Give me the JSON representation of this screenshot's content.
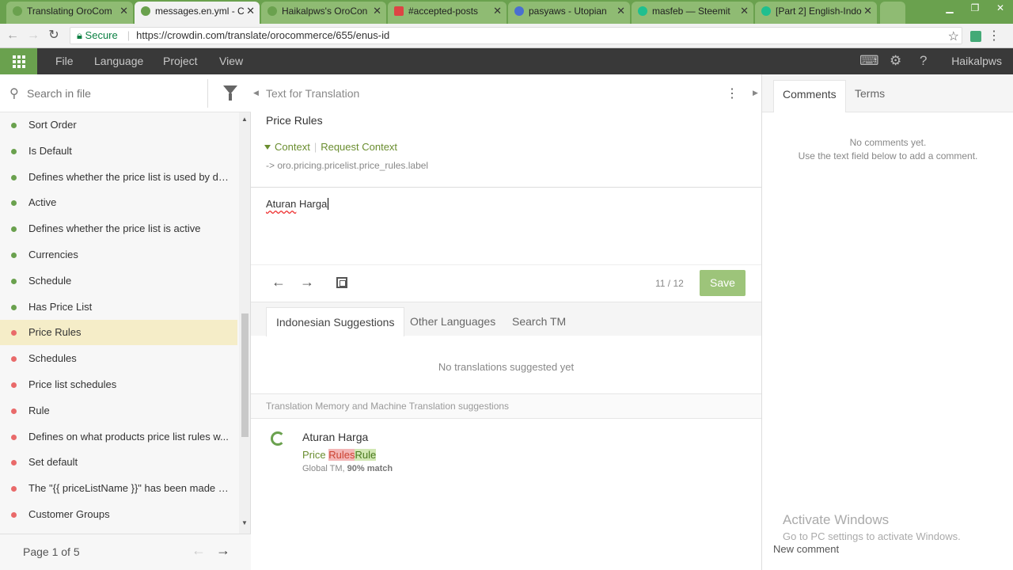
{
  "browser": {
    "tabs": [
      {
        "title": "Translating OroCom",
        "active": false
      },
      {
        "title": "messages.en.yml - C",
        "active": true
      },
      {
        "title": "Haikalpws's OroCon",
        "active": false
      },
      {
        "title": "#accepted-posts",
        "active": false
      },
      {
        "title": "pasyaws - Utopian",
        "active": false
      },
      {
        "title": "masfeb — Steemit",
        "active": false
      },
      {
        "title": "[Part 2] English-Indo",
        "active": false
      }
    ],
    "secure_label": "Secure",
    "url": "https://crowdin.com/translate/orocommerce/655/enus-id"
  },
  "appbar": {
    "menu": [
      "File",
      "Language",
      "Project",
      "View"
    ],
    "username": "Haikalpws",
    "icons": [
      "keyboard-icon",
      "gear-icon",
      "help-icon"
    ]
  },
  "left": {
    "search_placeholder": "Search in file",
    "items": [
      {
        "label": "Sort Order",
        "status": "green"
      },
      {
        "label": "Is Default",
        "status": "green"
      },
      {
        "label": "Defines whether the price list is used by de...",
        "status": "green"
      },
      {
        "label": "Active",
        "status": "green"
      },
      {
        "label": "Defines whether the price list is active",
        "status": "green"
      },
      {
        "label": "Currencies",
        "status": "green"
      },
      {
        "label": "Schedule",
        "status": "green"
      },
      {
        "label": "Has Price List",
        "status": "green"
      },
      {
        "label": "Price Rules",
        "status": "red",
        "selected": true
      },
      {
        "label": "Schedules",
        "status": "red"
      },
      {
        "label": "Price list schedules",
        "status": "red"
      },
      {
        "label": "Rule",
        "status": "red"
      },
      {
        "label": "Defines on what products price list rules w...",
        "status": "red"
      },
      {
        "label": "Set default",
        "status": "red"
      },
      {
        "label": "The \"{{ priceListName }}\" has been made d...",
        "status": "red"
      },
      {
        "label": "Customer Groups",
        "status": "red"
      }
    ],
    "pager": "Page 1 of 5"
  },
  "editor": {
    "header": "Text for Translation",
    "source_text": "Price Rules",
    "context_label": "Context",
    "request_context": "Request Context",
    "context_key": "-> oro.pricing.pricelist.price_rules.label",
    "translation_word1": "Aturan",
    "translation_word2": "Harga",
    "counter": "11 / 12",
    "save_label": "Save",
    "sug_tabs": [
      "Indonesian Suggestions",
      "Other Languages",
      "Search TM"
    ],
    "no_suggestions": "No translations suggested yet",
    "tm_header": "Translation Memory and Machine Translation suggestions",
    "tm": {
      "translation": "Aturan Harga",
      "src_prefix": "Price ",
      "src_deleted": "Rules",
      "src_inserted": "Rule",
      "meta_source": "Global TM,",
      "meta_match": "90% match"
    }
  },
  "right": {
    "tabs": [
      "Comments",
      "Terms"
    ],
    "no_comments_1": "No comments yet.",
    "no_comments_2": "Use the text field below to add a comment.",
    "watermark_1": "Activate Windows",
    "watermark_2": "Go to PC settings to activate Windows.",
    "new_comment": "New comment"
  },
  "colors": {
    "brand_green": "#6aa14e",
    "save_button": "#9dc47a",
    "selected_row": "#f5edc8"
  }
}
